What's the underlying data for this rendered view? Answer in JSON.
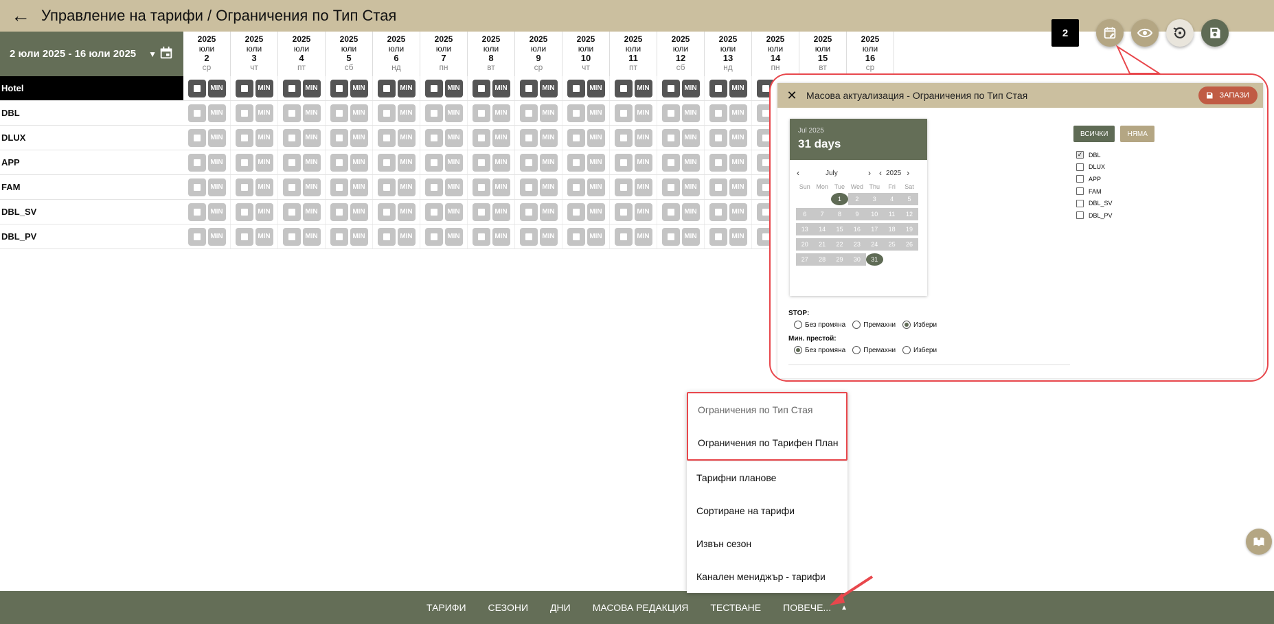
{
  "header": {
    "title": "Управление на тарифи / Ограничения по Тип Стая"
  },
  "toolbar": {
    "badge": "2",
    "icons": [
      "calendar-edit-icon",
      "eye-icon",
      "history-icon",
      "save-icon"
    ],
    "colors": {
      "gold": "#b4a683",
      "dark": "#5f6b55",
      "light": "#e9e5dc"
    }
  },
  "date_range": {
    "label": "2 юли 2025 - 16 юли 2025"
  },
  "days": [
    {
      "year": "2025",
      "month": "юли",
      "day": "2",
      "weekday": "ср"
    },
    {
      "year": "2025",
      "month": "юли",
      "day": "3",
      "weekday": "чт"
    },
    {
      "year": "2025",
      "month": "юли",
      "day": "4",
      "weekday": "пт"
    },
    {
      "year": "2025",
      "month": "юли",
      "day": "5",
      "weekday": "сб"
    },
    {
      "year": "2025",
      "month": "юли",
      "day": "6",
      "weekday": "нд"
    },
    {
      "year": "2025",
      "month": "юли",
      "day": "7",
      "weekday": "пн"
    },
    {
      "year": "2025",
      "month": "юли",
      "day": "8",
      "weekday": "вт"
    },
    {
      "year": "2025",
      "month": "юли",
      "day": "9",
      "weekday": "ср"
    },
    {
      "year": "2025",
      "month": "юли",
      "day": "10",
      "weekday": "чт"
    },
    {
      "year": "2025",
      "month": "юли",
      "day": "11",
      "weekday": "пт"
    },
    {
      "year": "2025",
      "month": "юли",
      "day": "12",
      "weekday": "сб"
    },
    {
      "year": "2025",
      "month": "юли",
      "day": "13",
      "weekday": "нд"
    },
    {
      "year": "2025",
      "month": "юли",
      "day": "14",
      "weekday": "пн"
    },
    {
      "year": "2025",
      "month": "юли",
      "day": "15",
      "weekday": "вт"
    },
    {
      "year": "2025",
      "month": "юли",
      "day": "16",
      "weekday": "ср"
    }
  ],
  "rows": [
    "Hotel",
    "DBL",
    "DLUX",
    "APP",
    "FAM",
    "DBL_SV",
    "DBL_PV"
  ],
  "cell_min_label": "MIN",
  "bulk_panel": {
    "title": "Масова актуализация - Ограничения по Тип Стая",
    "save_label": "ЗАПАЗИ",
    "calendar": {
      "header_small": "Jul 2025",
      "header_big": "31 days",
      "month": "July",
      "year": "2025",
      "weekdays": [
        "Sun",
        "Mon",
        "Tue",
        "Wed",
        "Thu",
        "Fri",
        "Sat"
      ],
      "weeks": [
        [
          "",
          "",
          "1",
          "2",
          "3",
          "4",
          "5"
        ],
        [
          "6",
          "7",
          "8",
          "9",
          "10",
          "11",
          "12"
        ],
        [
          "13",
          "14",
          "15",
          "16",
          "17",
          "18",
          "19"
        ],
        [
          "20",
          "21",
          "22",
          "23",
          "24",
          "25",
          "26"
        ],
        [
          "27",
          "28",
          "29",
          "30",
          "31",
          "",
          ""
        ]
      ],
      "selected": [
        "1",
        "31"
      ]
    },
    "stop": {
      "label": "STOP:",
      "options": [
        "Без промяна",
        "Премахни",
        "Избери"
      ],
      "selected": "Избери"
    },
    "min_stay": {
      "label": "Мин. престой:",
      "options": [
        "Без промяна",
        "Премахни",
        "Избери"
      ],
      "selected": "Без промяна"
    },
    "all_label": "ВСИЧКИ",
    "none_label": "НЯМА",
    "room_types": [
      {
        "name": "DBL",
        "checked": true
      },
      {
        "name": "DLUX",
        "checked": false
      },
      {
        "name": "APP",
        "checked": false
      },
      {
        "name": "FAM",
        "checked": false
      },
      {
        "name": "DBL_SV",
        "checked": false
      },
      {
        "name": "DBL_PV",
        "checked": false
      }
    ]
  },
  "more_menu": {
    "items": [
      "Ограничения по Тип Стая",
      "Ограничения по Тарифен План",
      "Тарифни планове",
      "Сортиране на тарифи",
      "Извън сезон",
      "Канален мениджър - тарифи"
    ]
  },
  "bottom_nav": {
    "items": [
      "ТАРИФИ",
      "СЕЗОНИ",
      "ДНИ",
      "МАСОВА РЕДАКЦИЯ",
      "ТЕСТВАНЕ",
      "ПОВЕЧЕ..."
    ]
  },
  "annotation_color": "#e8474c"
}
